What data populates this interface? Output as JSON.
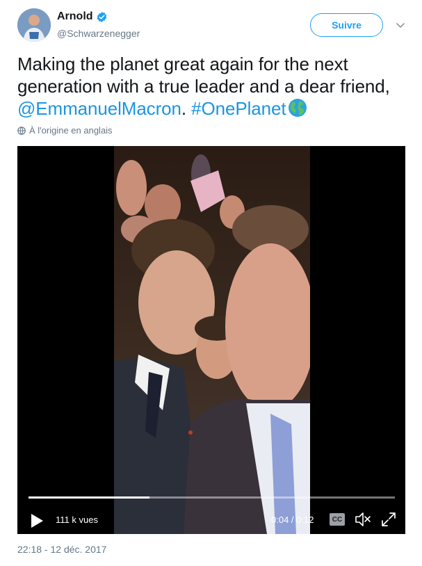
{
  "user": {
    "display_name": "Arnold",
    "handle": "@Schwarzenegger",
    "verified_icon": "verified-badge-icon",
    "avatar_icon": "profile-avatar"
  },
  "header": {
    "follow_label": "Suivre",
    "menu_icon": "chevron-down-icon"
  },
  "tweet": {
    "text_plain_1": "Making the planet great again for the next generation with a true leader and a dear friend, ",
    "mention": "@EmmanuelMacron",
    "text_plain_2": ". ",
    "hashtag": "#OnePlanet",
    "emoji_icon": "globe-emoji",
    "translate_label": "À l'origine en anglais",
    "timestamp": "22:18 - 12 déc. 2017"
  },
  "video": {
    "views": "111 k vues",
    "time": "0:04 / 0:12",
    "cc_label": "CC",
    "progress": 0.33,
    "play_icon": "play-icon",
    "mute_icon": "mute-icon",
    "fullscreen_icon": "fullscreen-icon"
  },
  "colors": {
    "link": "#1b95e0",
    "follow": "#1da1f2",
    "muted_text": "#657786"
  }
}
